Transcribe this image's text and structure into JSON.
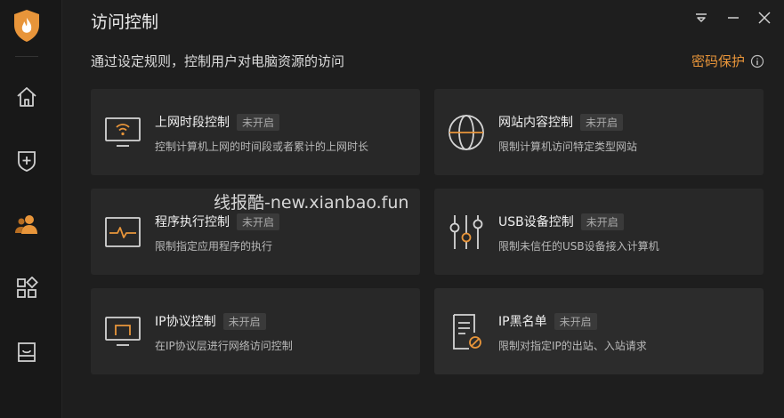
{
  "window": {
    "title": "访问控制",
    "subtitle": "通过设定规则，控制用户对电脑资源的访问",
    "password_protect": "密码保护",
    "controls": [
      "menu-icon",
      "minimize-icon",
      "close-icon"
    ]
  },
  "colors": {
    "accent": "#e8953a",
    "background": "#1e1e1e",
    "card": "#282828",
    "sidebar": "#181818"
  },
  "sidebar": {
    "logo": "shield-flame-logo",
    "items": [
      {
        "icon": "home-icon",
        "active": false
      },
      {
        "icon": "shield-plus-icon",
        "active": false
      },
      {
        "icon": "users-icon",
        "active": true
      },
      {
        "icon": "apps-icon",
        "active": false
      },
      {
        "icon": "toolbox-icon",
        "active": false
      }
    ]
  },
  "cards": [
    {
      "title": "上网时段控制",
      "status": "未开启",
      "desc": "控制计算机上网的时间段或者累计的上网时长",
      "icon": "monitor-wifi-icon"
    },
    {
      "title": "网站内容控制",
      "status": "未开启",
      "desc": "限制计算机访问特定类型网站",
      "icon": "globe-icon"
    },
    {
      "title": "程序执行控制",
      "status": "未开启",
      "desc": "限制指定应用程序的执行",
      "icon": "program-pulse-icon"
    },
    {
      "title": "USB设备控制",
      "status": "未开启",
      "desc": "限制未信任的USB设备接入计算机",
      "icon": "sliders-icon"
    },
    {
      "title": "IP协议控制",
      "status": "未开启",
      "desc": "在IP协议层进行网络访问控制",
      "icon": "ip-monitor-icon"
    },
    {
      "title": "IP黑名单",
      "status": "未开启",
      "desc": "限制对指定IP的出站、入站请求",
      "icon": "blocklist-doc-icon"
    }
  ],
  "watermark": "线报酷-new.xianbao.fun"
}
